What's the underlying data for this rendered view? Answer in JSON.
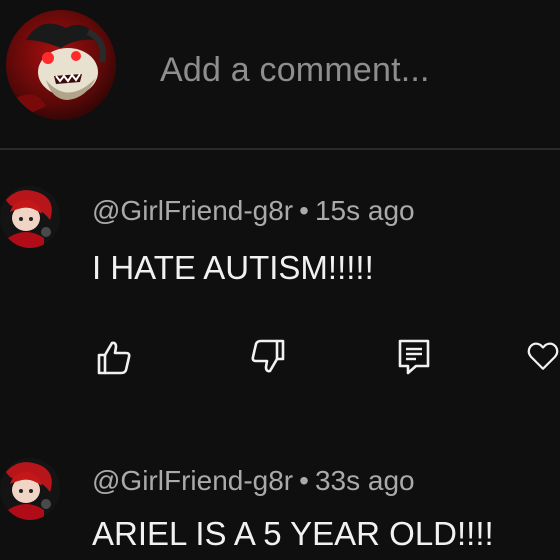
{
  "composer": {
    "placeholder": "Add a comment..."
  },
  "comments": [
    {
      "handle": "@GirlFriend-g8r",
      "separator": "•",
      "time": "15s ago",
      "text": "I HATE AUTISM!!!!!"
    },
    {
      "handle": "@GirlFriend-g8r",
      "separator": "•",
      "time": "33s ago",
      "text": "ARIEL IS A 5 YEAR OLD!!!!"
    }
  ],
  "actions": {
    "icons": [
      "thumbs-up-icon",
      "thumbs-down-icon",
      "reply-icon",
      "heart-icon"
    ]
  },
  "colors": {
    "background": "#0f0f0f",
    "text": "#f1f1f1",
    "meta": "#aaaaaa",
    "placeholder": "#8e8e8e",
    "divider": "#2a2a2a",
    "avatar_red": "#c41818"
  }
}
